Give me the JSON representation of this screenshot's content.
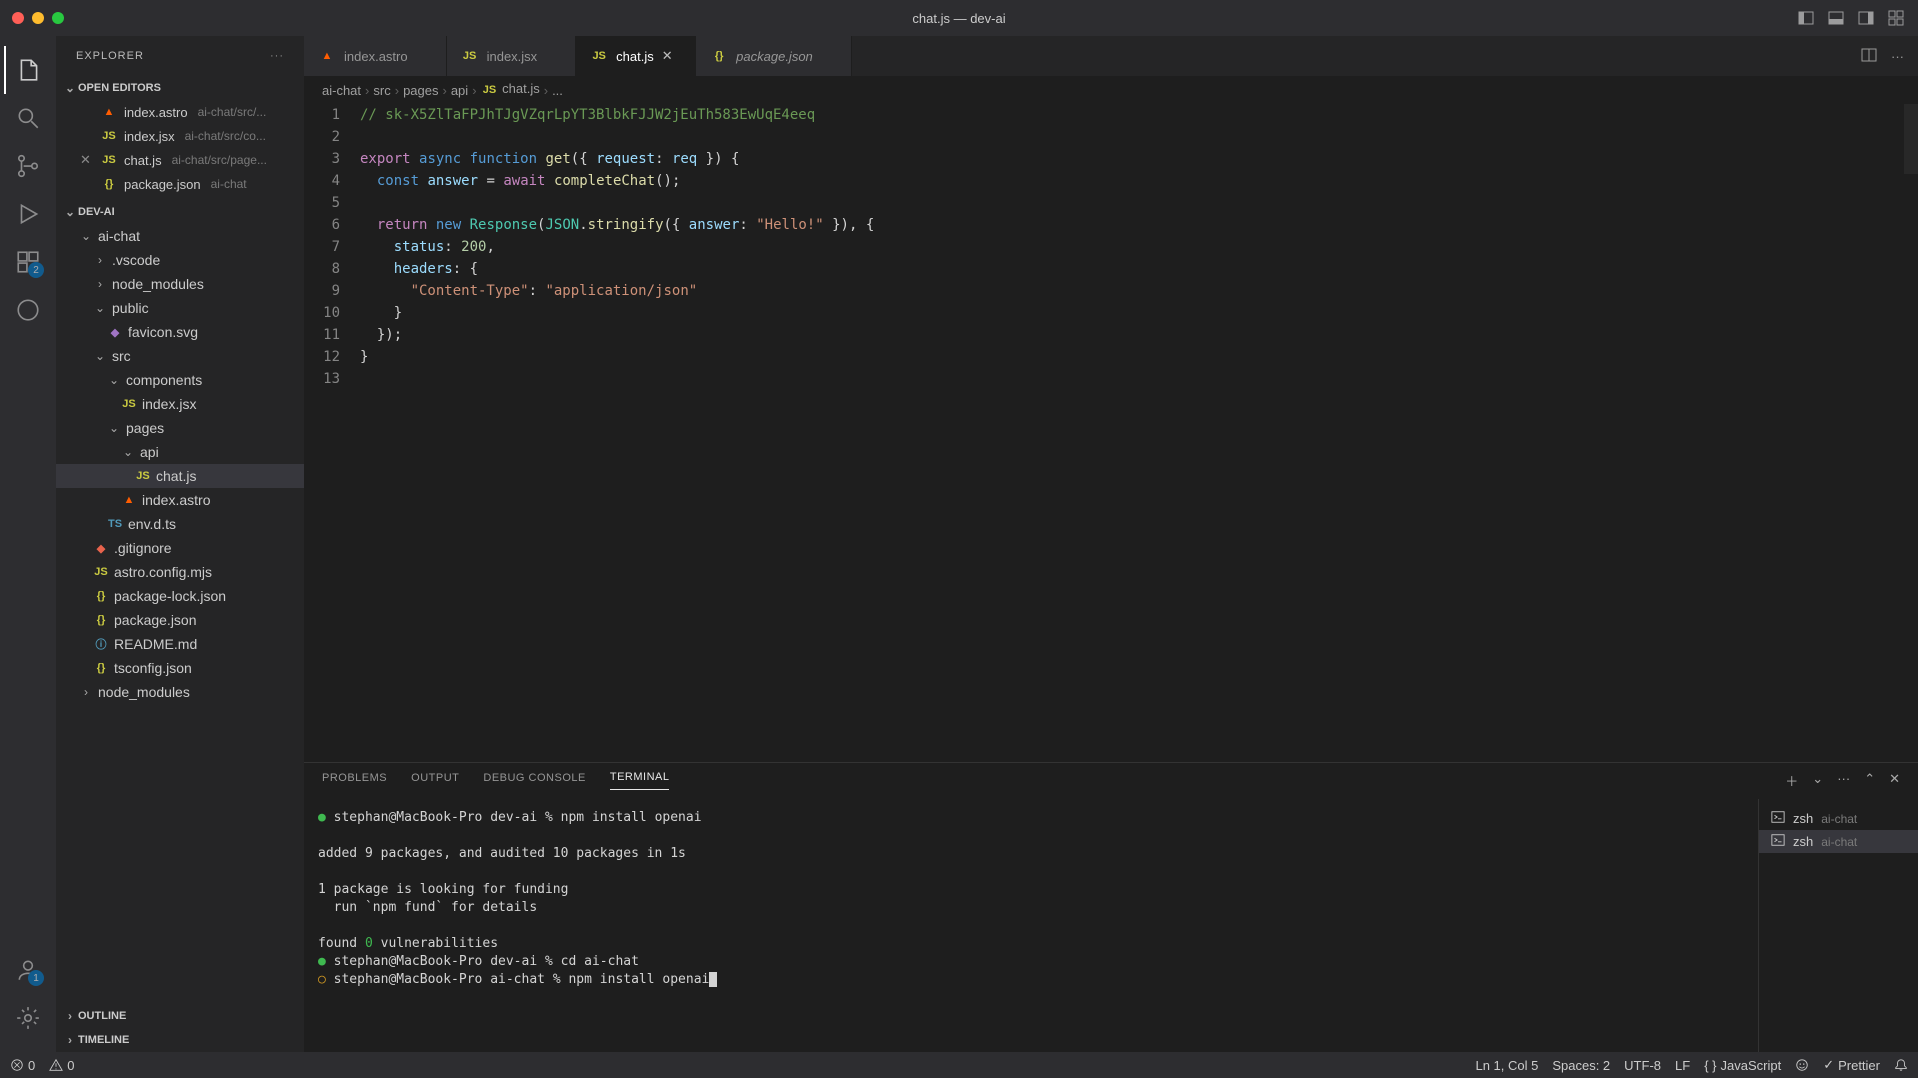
{
  "window": {
    "title": "chat.js — dev-ai"
  },
  "sidebar": {
    "title": "EXPLORER",
    "sections": {
      "openEditors": {
        "label": "OPEN EDITORS",
        "items": [
          {
            "icon": "astro",
            "name": "index.astro",
            "path": "ai-chat/src/..."
          },
          {
            "icon": "jsx",
            "name": "index.jsx",
            "path": "ai-chat/src/co..."
          },
          {
            "icon": "js",
            "name": "chat.js",
            "path": "ai-chat/src/page..."
          },
          {
            "icon": "json",
            "name": "package.json",
            "path": "ai-chat"
          }
        ]
      },
      "workspace": {
        "label": "DEV-AI"
      },
      "outline": {
        "label": "OUTLINE"
      },
      "timeline": {
        "label": "TIMELINE"
      }
    },
    "tree": [
      {
        "level": 1,
        "type": "folder-open",
        "name": "ai-chat"
      },
      {
        "level": 2,
        "type": "folder",
        "name": ".vscode"
      },
      {
        "level": 2,
        "type": "folder",
        "name": "node_modules"
      },
      {
        "level": 2,
        "type": "folder-open",
        "name": "public"
      },
      {
        "level": 3,
        "type": "svg",
        "name": "favicon.svg"
      },
      {
        "level": 2,
        "type": "folder-open",
        "name": "src"
      },
      {
        "level": 3,
        "type": "folder-open",
        "name": "components"
      },
      {
        "level": 4,
        "type": "jsx",
        "name": "index.jsx"
      },
      {
        "level": 3,
        "type": "folder-open",
        "name": "pages"
      },
      {
        "level": 4,
        "type": "folder-open",
        "name": "api"
      },
      {
        "level": 5,
        "type": "js",
        "name": "chat.js",
        "selected": true
      },
      {
        "level": 4,
        "type": "astro",
        "name": "index.astro"
      },
      {
        "level": 3,
        "type": "ts",
        "name": "env.d.ts"
      },
      {
        "level": 2,
        "type": "git",
        "name": ".gitignore"
      },
      {
        "level": 2,
        "type": "js",
        "name": "astro.config.mjs"
      },
      {
        "level": 2,
        "type": "json",
        "name": "package-lock.json"
      },
      {
        "level": 2,
        "type": "json",
        "name": "package.json"
      },
      {
        "level": 2,
        "type": "md",
        "name": "README.md"
      },
      {
        "level": 2,
        "type": "json",
        "name": "tsconfig.json"
      },
      {
        "level": 1,
        "type": "folder",
        "name": "node_modules"
      }
    ]
  },
  "activitybar": {
    "extensions_badge": "2",
    "accounts_badge": "1"
  },
  "tabs": [
    {
      "icon": "astro",
      "label": "index.astro",
      "active": false
    },
    {
      "icon": "jsx",
      "label": "index.jsx",
      "active": false
    },
    {
      "icon": "js",
      "label": "chat.js",
      "active": true
    },
    {
      "icon": "json",
      "label": "package.json",
      "active": false,
      "italic": true
    }
  ],
  "breadcrumb": [
    "ai-chat",
    "src",
    "pages",
    "api",
    "chat.js",
    "..."
  ],
  "code": {
    "lines": [
      {
        "n": 1,
        "html": "<span class='c-comment'>// 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</span>"
      },
      {
        "n": 2,
        "html": ""
      },
      {
        "n": 3,
        "html": "<span class='c-keyword'>export</span> <span class='c-storage'>async function</span> <span class='c-func'>get</span><span class='c-plain'>({ </span><span class='c-var'>request</span><span class='c-plain'>: </span><span class='c-var'>req</span><span class='c-plain'> }) {</span>"
      },
      {
        "n": 4,
        "html": "  <span class='c-storage'>const</span> <span class='c-var'>answer</span> <span class='c-plain'>=</span> <span class='c-keyword'>await</span> <span class='c-func'>completeChat</span><span class='c-plain'>();</span>"
      },
      {
        "n": 5,
        "html": ""
      },
      {
        "n": 6,
        "html": "  <span class='c-keyword'>return</span> <span class='c-storage'>new</span> <span class='c-type'>Response</span><span class='c-plain'>(</span><span class='c-type'>JSON</span><span class='c-plain'>.</span><span class='c-func'>stringify</span><span class='c-plain'>({ </span><span class='c-var'>answer</span><span class='c-plain'>: </span><span class='c-string'>\"Hello!\"</span><span class='c-plain'> }), {</span>"
      },
      {
        "n": 7,
        "html": "    <span class='c-var'>status</span><span class='c-plain'>: </span><span class='c-num'>200</span><span class='c-plain'>,</span>"
      },
      {
        "n": 8,
        "html": "    <span class='c-var'>headers</span><span class='c-plain'>: {</span>"
      },
      {
        "n": 9,
        "html": "      <span class='c-string'>\"Content-Type\"</span><span class='c-plain'>: </span><span class='c-string'>\"application/json\"</span>"
      },
      {
        "n": 10,
        "html": "    <span class='c-plain'>}</span>"
      },
      {
        "n": 11,
        "html": "  <span class='c-plain'>});</span>"
      },
      {
        "n": 12,
        "html": "<span class='c-plain'>}</span>"
      },
      {
        "n": 13,
        "html": ""
      }
    ]
  },
  "panel": {
    "tabs": [
      "PROBLEMS",
      "OUTPUT",
      "DEBUG CONSOLE",
      "TERMINAL"
    ],
    "activeTab": "TERMINAL",
    "terminalList": [
      {
        "shell": "zsh",
        "cwd": "ai-chat",
        "active": false
      },
      {
        "shell": "zsh",
        "cwd": "ai-chat",
        "active": true
      }
    ],
    "terminal": {
      "line1": {
        "prompt": "stephan@MacBook-Pro",
        "dir": "dev-ai",
        "cmd": "npm install openai"
      },
      "line2": "added 9 packages, and audited 10 packages in 1s",
      "line3": "1 package is looking for funding",
      "line4": "  run `npm fund` for details",
      "line5_a": "found ",
      "line5_b": "0",
      "line5_c": " vulnerabilities",
      "line6": {
        "prompt": "stephan@MacBook-Pro",
        "dir": "dev-ai",
        "cmd": "cd ai-chat"
      },
      "line7": {
        "prompt": "stephan@MacBook-Pro",
        "dir": "ai-chat",
        "cmd": "npm install openai"
      }
    }
  },
  "statusbar": {
    "errors": "0",
    "warnings": "0",
    "cursor": "Ln 1, Col 5",
    "spaces": "Spaces: 2",
    "encoding": "UTF-8",
    "eol": "LF",
    "language": "JavaScript",
    "prettier": "Prettier"
  }
}
